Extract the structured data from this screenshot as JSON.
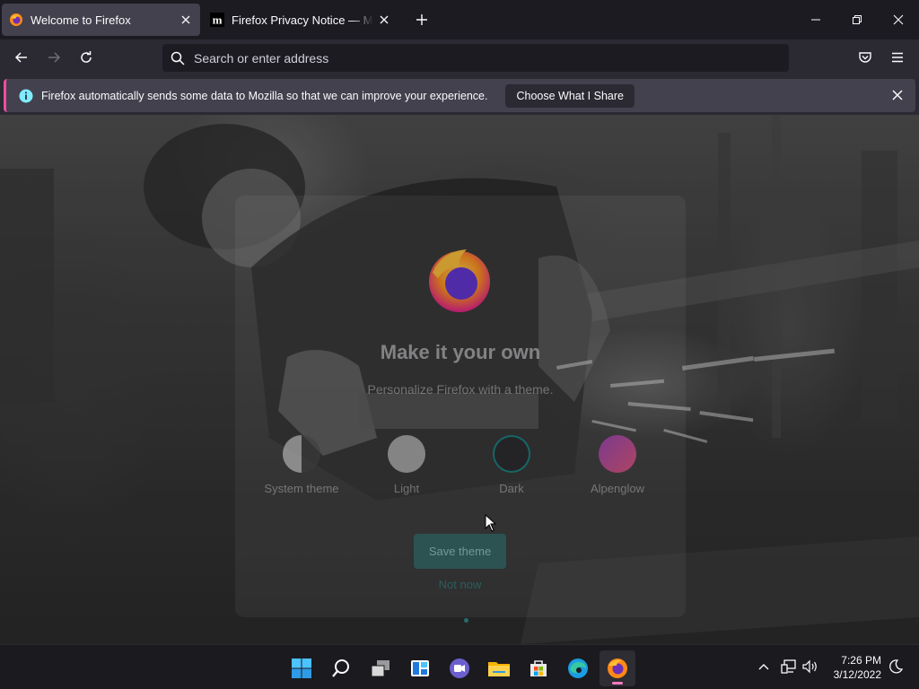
{
  "browser": {
    "tabs": [
      {
        "title": "Welcome to Firefox",
        "active": true
      },
      {
        "title": "Firefox Privacy Notice — Mozilla",
        "active": false
      }
    ],
    "address_placeholder": "Search or enter address"
  },
  "notification": {
    "message": "Firefox automatically sends some data to Mozilla so that we can improve your experience.",
    "button_label": "Choose What I Share"
  },
  "welcome": {
    "heading": "Make it your own",
    "subheading": "Personalize Firefox with a theme.",
    "themes": [
      {
        "label": "System theme"
      },
      {
        "label": "Light"
      },
      {
        "label": "Dark"
      },
      {
        "label": "Alpenglow"
      }
    ],
    "save_label": "Save theme",
    "not_now_label": "Not now"
  },
  "taskbar": {
    "apps": [
      "windows-start-icon",
      "search-icon",
      "task-view-icon",
      "widgets-icon",
      "teams-chat-icon",
      "file-explorer-icon",
      "microsoft-store-icon",
      "edge-icon",
      "firefox-icon"
    ],
    "time": "7:26 PM",
    "date": "3/12/2022"
  },
  "colors": {
    "accent": "#ff4aa2",
    "tab_active": "#42414d",
    "toolbar": "#2b2a33",
    "frame": "#1c1b22"
  }
}
